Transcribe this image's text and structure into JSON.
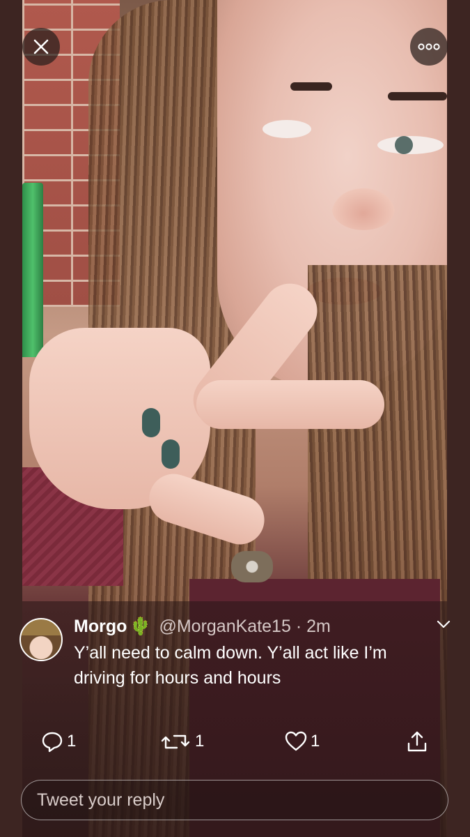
{
  "controls": {
    "close_icon": "close-icon",
    "more_icon": "more-options-icon"
  },
  "tweet": {
    "display_name": "Morgo",
    "name_emoji": "🌵",
    "handle": "@MorganKate15",
    "separator": "·",
    "time": "2m",
    "text": "Y’all need to calm down. Y’all act like I’m driving for hours and hours",
    "reply_count": "1",
    "retweet_count": "1",
    "like_count": "1"
  },
  "reply_box": {
    "placeholder": "Tweet your reply"
  },
  "colors": {
    "background": "#3d2522",
    "text": "#ffffff",
    "muted": "#d5c8c6"
  }
}
